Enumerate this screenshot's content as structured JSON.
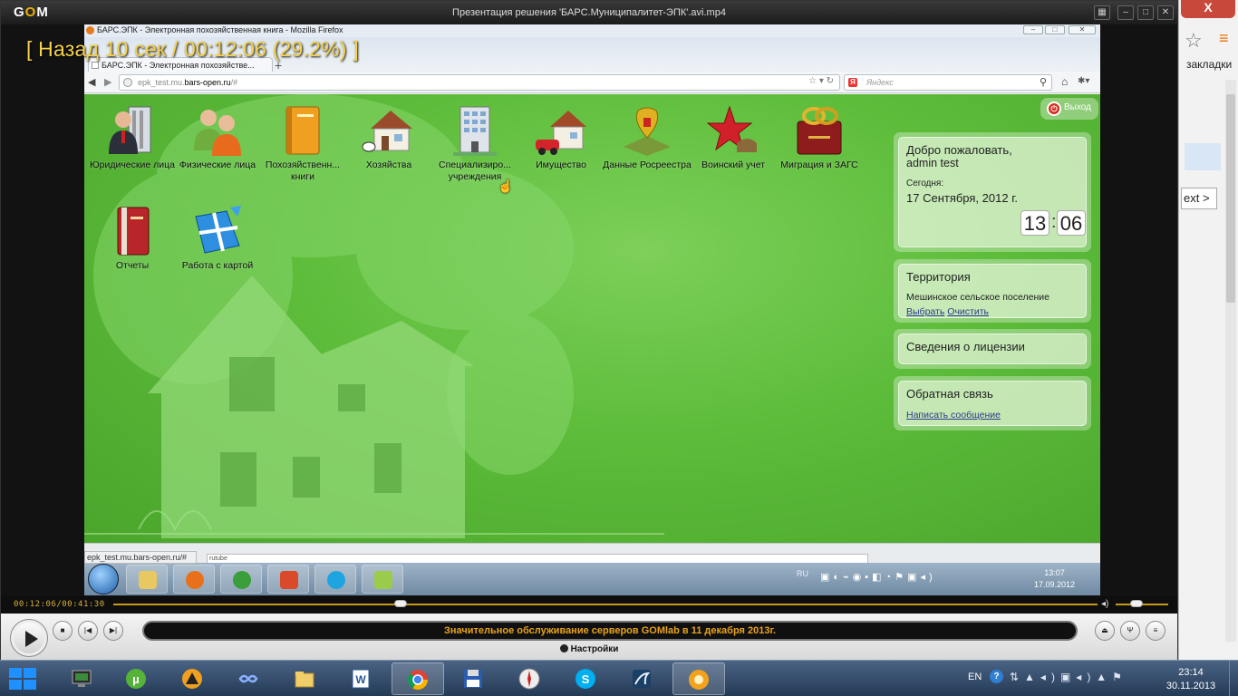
{
  "bg_browser": {
    "close_label": "X",
    "bookmarks_label": "закладки",
    "next_label": "ext >"
  },
  "player": {
    "logo_g": "G",
    "logo_o": "O",
    "logo_m": "M",
    "title": "Презентация решения 'БАРС.Муниципалитет-ЭПК'.avi.mp4",
    "osd": "[ Назад 10 сек / 00:12:06 (29.2%) ]",
    "time_readout": "00:12:06/00:41:30",
    "progress_fraction": 0.292,
    "volume_fraction": 0.4,
    "marquee": "Значительное обслуживание серверов GOMlab в 11 декабря 2013г.",
    "settings_label": "Настройки"
  },
  "firefox": {
    "window_title": "БАРС.ЭПК - Электронная похозяйственная книга - Mozilla Firefox",
    "tab_label": "БАРС.ЭПК - Электронная похозяйстве...",
    "new_tab_label": "+",
    "url_prefix": "epk_test.mu.",
    "url_host": "bars-open.ru",
    "url_suffix": "/#",
    "search_placeholder": "Яндекс",
    "search_engine_letter": "Я",
    "status_link": "epk_test.mu.bars-open.ru/#",
    "bottom_bar_text": "rutube"
  },
  "app": {
    "logout_label": "Выход",
    "icons": [
      {
        "label": "Юридические лица"
      },
      {
        "label": "Физические лица"
      },
      {
        "label": "Похозяйственн... книги"
      },
      {
        "label": "Хозяйства"
      },
      {
        "label": "Специализиро... учреждения"
      },
      {
        "label": "Имущество"
      },
      {
        "label": "Данные Росреестра"
      },
      {
        "label": "Воинский учет"
      },
      {
        "label": "Миграция и ЗАГС"
      },
      {
        "label": "Отчеты"
      },
      {
        "label": "Работа с картой"
      }
    ],
    "welcome": {
      "title": "Добро пожаловать,",
      "user": "admin test",
      "today_label": "Сегодня:",
      "date": "17 Сентября, 2012 г.",
      "hour": "13",
      "minute": "06"
    },
    "territory": {
      "title": "Территория",
      "value": "Мешинское сельское поселение",
      "select_link": "Выбрать",
      "clear_link": "Очистить"
    },
    "license": {
      "title": "Сведения о лицензии"
    },
    "feedback": {
      "title": "Обратная связь",
      "link": "Написать сообщение"
    }
  },
  "video_taskbar": {
    "lang": "RU",
    "time": "13:07",
    "date": "17.09.2012"
  },
  "taskbar": {
    "lang": "EN",
    "time": "23:14",
    "date": "30.11.2013"
  },
  "colors": {
    "page_green": "#5dbc3a",
    "gom_accent": "#c79a18",
    "marquee_text": "#e9a31b"
  }
}
